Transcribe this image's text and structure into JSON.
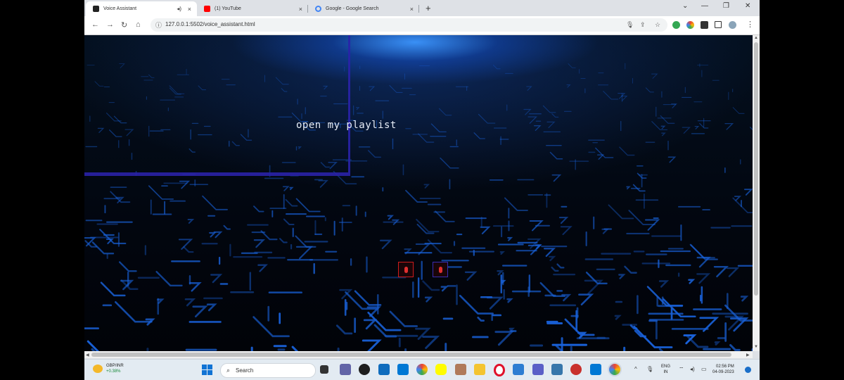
{
  "tabs": [
    {
      "title": "Voice Assistant",
      "close": "×",
      "extra": "◂)"
    },
    {
      "title": "(1) YouTube",
      "close": "×"
    },
    {
      "title": "Google - Google Search",
      "close": "×"
    }
  ],
  "new_tab": "+",
  "window_controls": {
    "chevron": "⌄",
    "minimize": "—",
    "restore": "❐",
    "close": "✕"
  },
  "nav": {
    "back": "←",
    "forward": "→",
    "reload": "↻",
    "home": "⌂"
  },
  "address": {
    "url": "127.0.0.1:5502/voice_assistant.html",
    "info_icon": "ⓘ"
  },
  "omnibox_icons": {
    "mic": "🎙",
    "share": "⇪",
    "star": "☆"
  },
  "page": {
    "transcript": "open my playlist"
  },
  "taskbar": {
    "weather": {
      "symbol": "GBP/INR",
      "change": "+0.38%"
    },
    "search_placeholder": "Search",
    "lang": {
      "line1": "ENG",
      "line2": "IN"
    },
    "clock": {
      "time": "02:56 PM",
      "date": "04-09-2023"
    },
    "tray_chevron": "^"
  },
  "colors": {
    "accent_blue": "#1e73ff",
    "mic_red": "#d01c1c",
    "frame_purple": "#3a2cb0"
  }
}
